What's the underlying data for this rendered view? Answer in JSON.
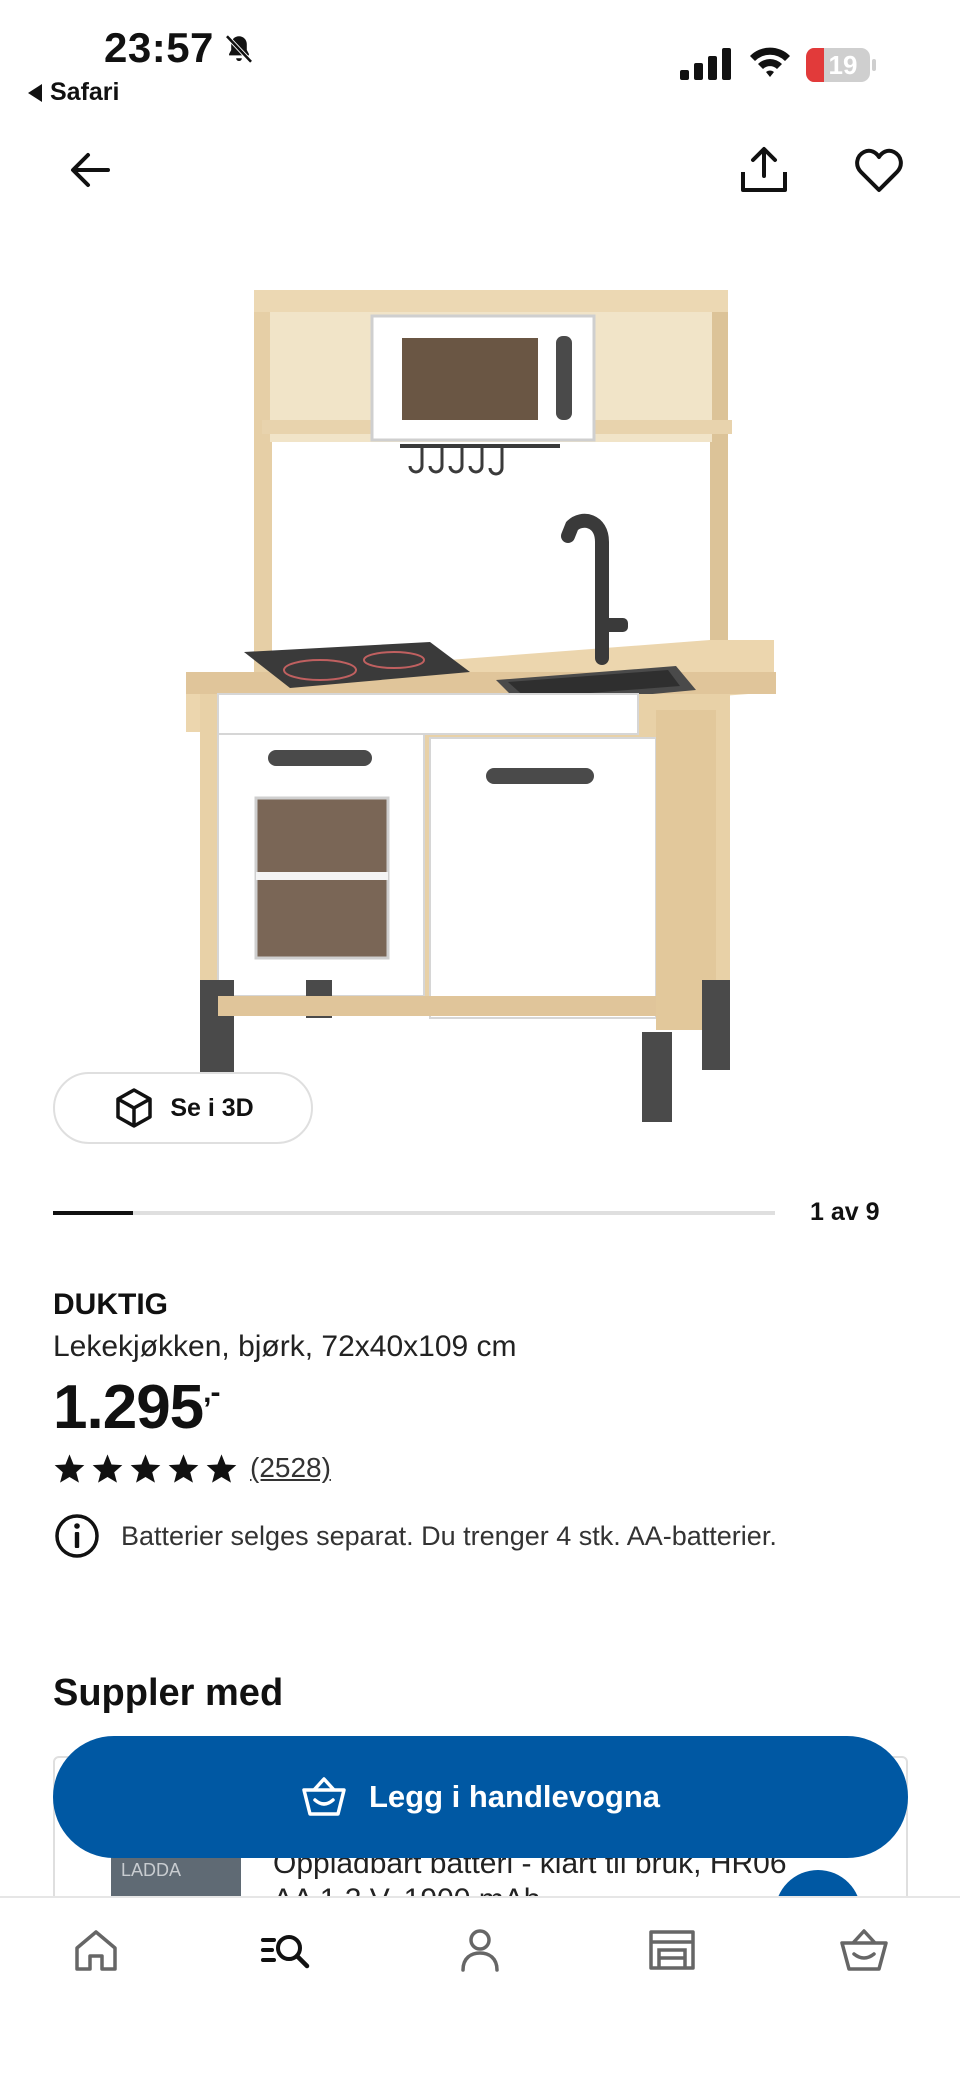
{
  "status_bar": {
    "time": "23:57",
    "back_app": "Safari",
    "battery_level": "19"
  },
  "icons": {
    "nav_back": "arrow-left-icon",
    "share": "share-icon",
    "favorite": "heart-icon",
    "view_3d": "cube-icon",
    "info": "info-icon",
    "cart": "basket-icon"
  },
  "gallery": {
    "view_3d_label": "Se i 3D",
    "counter": "1 av 9",
    "position": 1,
    "total": 9
  },
  "product": {
    "name": "DUKTIG",
    "description": "Lekekjøkken, bjørk, 72x40x109 cm",
    "price": "1.295",
    "price_suffix": ",-",
    "rating_stars": 5,
    "review_count": "(2528)",
    "notice": "Batterier selges separat. Du trenger 4 stk. AA-batterier."
  },
  "complements": {
    "title": "Suppler med",
    "item_thumb_text": "LADDA",
    "item_text": "Oppladbart batteri - klart til bruk, HR06 AA 1,2 V, 1900 mAh"
  },
  "cta": {
    "label": "Legg i handlevogna"
  },
  "tab_bar": {
    "items": [
      "home",
      "search-menu",
      "profile",
      "store",
      "cart"
    ],
    "active": "search-menu"
  },
  "colors": {
    "primary_blue": "#0058a3",
    "text": "#111111",
    "battery_red": "#e23a3a",
    "divider": "#dfdfdf"
  }
}
